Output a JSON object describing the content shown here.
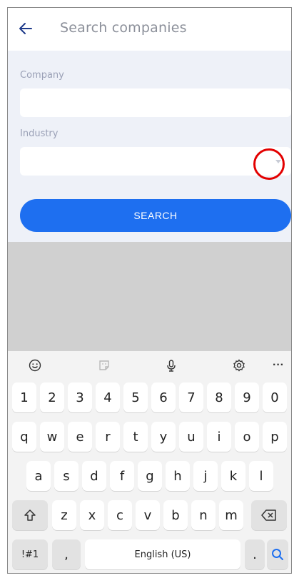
{
  "header": {
    "title": "Search companies"
  },
  "form": {
    "company_label": "Company",
    "company_value": "",
    "industry_label": "Industry",
    "industry_value": "",
    "search_label": "SEARCH"
  },
  "keyboard": {
    "toolbar": [
      "emoji-icon",
      "sticker-icon",
      "microphone-icon",
      "settings-icon",
      "more-icon"
    ],
    "more_label": "···",
    "row_numbers": [
      "1",
      "2",
      "3",
      "4",
      "5",
      "6",
      "7",
      "8",
      "9",
      "0"
    ],
    "row1": [
      "q",
      "w",
      "e",
      "r",
      "t",
      "y",
      "u",
      "i",
      "o",
      "p"
    ],
    "row2": [
      "a",
      "s",
      "d",
      "f",
      "g",
      "h",
      "j",
      "k",
      "l"
    ],
    "row3": [
      "z",
      "x",
      "c",
      "v",
      "b",
      "n",
      "m"
    ],
    "symbols_label": "!#1",
    "comma_label": ",",
    "space_label": "English (US)",
    "period_label": "."
  },
  "colors": {
    "accent": "#1e6ff0",
    "highlight_ring": "#e30000"
  }
}
